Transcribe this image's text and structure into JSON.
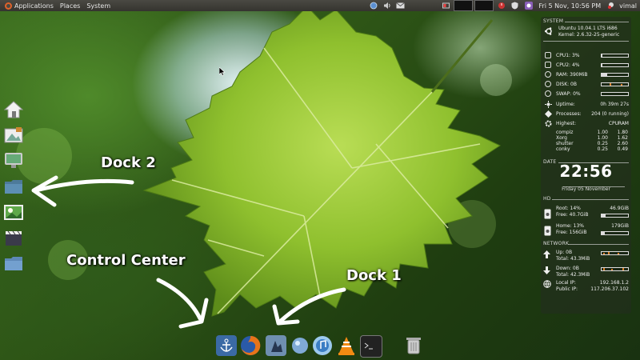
{
  "top_panel": {
    "menus": [
      "Applications",
      "Places",
      "System"
    ],
    "clock": "Fri 5 Nov, 10:56 PM",
    "user": "vimal"
  },
  "annotations": {
    "dock2": "Dock 2",
    "control_center": "Control Center",
    "dock1": "Dock 1"
  },
  "dock2_icons": [
    "home-icon",
    "image-viewer-icon",
    "monitor-icon",
    "folder-icon",
    "photo-gallery-icon",
    "video-clapper-icon",
    "folder-blue-icon"
  ],
  "dock1_icons": [
    "anchor-icon",
    "firefox-icon",
    "file-manager-icon",
    "ball-icon",
    "itunes-icon",
    "vlc-icon",
    "terminal-icon",
    "trash-icon"
  ],
  "conky": {
    "system": {
      "title": "SYSTEM",
      "os": "Ubuntu 10.04.1 LTS i686",
      "kernel": "Kernel: 2.6.32-25-generic",
      "cpu1": {
        "label": "CPU1: 3%",
        "percent": 3
      },
      "cpu2": {
        "label": "CPU2: 4%",
        "percent": 4
      },
      "ram": {
        "label": "RAM: 390MiB",
        "percent": 20
      },
      "disk": {
        "label": "DISK: 0B"
      },
      "swap": {
        "label": "SWAP: 0%",
        "percent": 0
      },
      "uptime_label": "Uptime:",
      "uptime_value": "0h 39m 27s",
      "processes_label": "Processes:",
      "processes_value": "204 (0 running)",
      "highest_label": "Highest:",
      "cpu_col": "CPU",
      "ram_col": "RAM",
      "top": [
        {
          "name": "compiz",
          "cpu": "1.00",
          "ram": "1.80"
        },
        {
          "name": "Xorg",
          "cpu": "1.00",
          "ram": "1.62"
        },
        {
          "name": "shutter",
          "cpu": "0.25",
          "ram": "2.60"
        },
        {
          "name": "conky",
          "cpu": "0.25",
          "ram": "0.49"
        }
      ]
    },
    "date": {
      "title": "DATE",
      "time": "22:56",
      "date": "Friday 05 November"
    },
    "hd": {
      "title": "HD",
      "root": {
        "used": "Root: 14%",
        "size": "46.9GiB",
        "free": "Free: 40.7GiB",
        "percent": 14
      },
      "home": {
        "used": "Home: 13%",
        "size": "179GiB",
        "free": "Free: 156GiB",
        "percent": 13
      }
    },
    "network": {
      "title": "NETWORK",
      "up": "Up: 0B",
      "up_total": "Total: 43.3MiB",
      "down": "Down: 0B",
      "down_total": "Total: 42.3MiB",
      "local_ip_label": "Local IP:",
      "local_ip": "192.168.1.2",
      "public_ip_label": "Public IP:",
      "public_ip": "117.206.37.102"
    }
  }
}
